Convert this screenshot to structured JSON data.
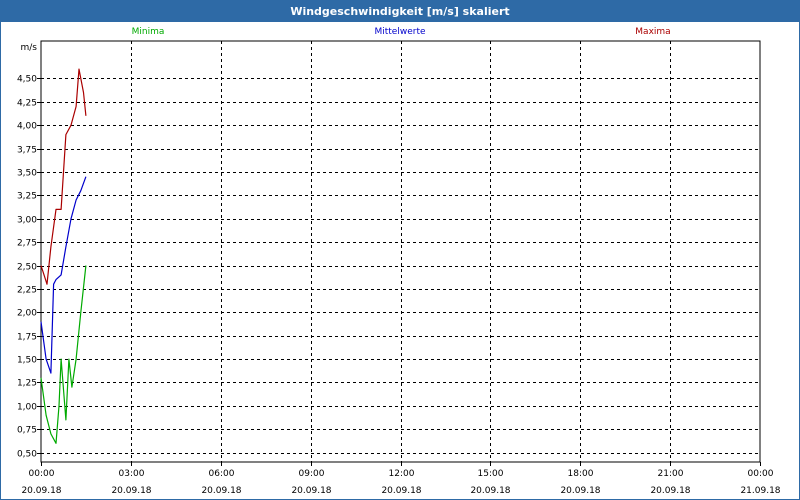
{
  "window": {
    "title": "Windgeschwindigkeit [m/s] skaliert"
  },
  "chart_data": {
    "type": "line",
    "title": "Windgeschwindigkeit [m/s] skaliert",
    "ylabel": "m/s",
    "ylim": [
      0.4,
      4.9
    ],
    "xlim": [
      0,
      24
    ],
    "grid": true,
    "legend_position": "top",
    "y_ticks": [
      "0,50",
      "0,75",
      "1,00",
      "1,25",
      "1,50",
      "1,75",
      "2,00",
      "2,25",
      "2,50",
      "2,75",
      "3,00",
      "3,25",
      "3,50",
      "3,75",
      "4,00",
      "4,25",
      "4,50"
    ],
    "x_ticks": [
      {
        "time": "00:00",
        "date": "20.09.18"
      },
      {
        "time": "03:00",
        "date": "20.09.18"
      },
      {
        "time": "06:00",
        "date": "20.09.18"
      },
      {
        "time": "09:00",
        "date": "20.09.18"
      },
      {
        "time": "12:00",
        "date": "20.09.18"
      },
      {
        "time": "15:00",
        "date": "20.09.18"
      },
      {
        "time": "18:00",
        "date": "20.09.18"
      },
      {
        "time": "21:00",
        "date": "20.09.18"
      },
      {
        "time": "00:00",
        "date": "21.09.18"
      }
    ],
    "x_unit": "hours since 20.09.18 00:00",
    "series": [
      {
        "name": "Minima",
        "color": "#00aa00",
        "x": [
          0.0,
          0.17,
          0.33,
          0.5,
          0.6,
          0.67,
          0.83,
          0.93,
          1.03,
          1.17,
          1.33,
          1.5
        ],
        "y": [
          1.3,
          0.9,
          0.7,
          0.6,
          1.0,
          1.5,
          0.85,
          1.5,
          1.2,
          1.5,
          2.0,
          2.5
        ]
      },
      {
        "name": "Mittelwerte",
        "color": "#0000cc",
        "x": [
          0.0,
          0.17,
          0.33,
          0.42,
          0.5,
          0.67,
          0.83,
          1.0,
          1.17,
          1.33,
          1.5
        ],
        "y": [
          1.9,
          1.5,
          1.35,
          2.3,
          2.35,
          2.4,
          2.7,
          3.0,
          3.2,
          3.3,
          3.45
        ]
      },
      {
        "name": "Maxima",
        "color": "#aa0000",
        "x": [
          0.0,
          0.2,
          0.33,
          0.5,
          0.67,
          0.83,
          1.0,
          1.17,
          1.27,
          1.42,
          1.5
        ],
        "y": [
          2.5,
          2.3,
          2.7,
          3.1,
          3.1,
          3.9,
          4.0,
          4.2,
          4.6,
          4.35,
          4.1
        ]
      }
    ]
  }
}
